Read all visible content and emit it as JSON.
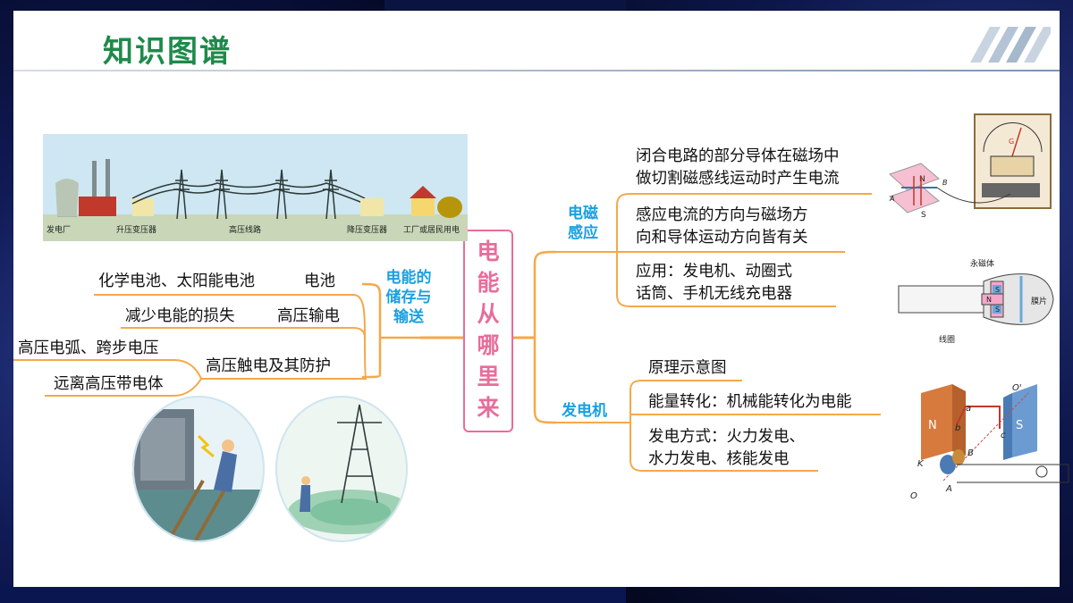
{
  "title": "知识图谱",
  "center": [
    "电",
    "能",
    "从",
    "哪",
    "里",
    "来"
  ],
  "left_branch": {
    "title_lines": [
      "电能的",
      "储存与",
      "输送"
    ],
    "battery": {
      "examples": "化学电池、太阳能电池",
      "label": "电池"
    },
    "hv": {
      "examples": "减少电能的损失",
      "label": "高压输电"
    },
    "shock": {
      "label": "高压触电及其防护",
      "items": [
        "高压电弧、跨步电压",
        "远离高压带电体"
      ]
    }
  },
  "right_branch": {
    "emi": {
      "title_lines": [
        "电磁",
        "感应"
      ],
      "items": [
        [
          "闭合电路的部分导体在磁场中",
          "做切割磁感线运动时产生电流"
        ],
        [
          "感应电流的方向与磁场方",
          "向和导体运动方向皆有关"
        ],
        [
          "应用：发电机、动圈式",
          "话筒、手机无线充电器"
        ]
      ]
    },
    "generator": {
      "title": "发电机",
      "items": [
        [
          "原理示意图"
        ],
        [
          "能量转化：机械能转化为电能"
        ],
        [
          "发电方式：火力发电、",
          "水力发电、核能发电"
        ]
      ]
    }
  },
  "transmission_labels": [
    "发电厂",
    "升压变压器",
    "高压线路",
    "降压变压器",
    "工厂或居民用电"
  ],
  "mic_labels": {
    "magnet": "永磁体",
    "diaphragm": "膜片",
    "coil": "线圈",
    "s1": "S",
    "n": "N",
    "s2": "S"
  },
  "generator_labels": {
    "n": "N",
    "s": "S",
    "a": "a",
    "b": "b",
    "c": "c",
    "o_prime": "O'",
    "o": "O",
    "k": "K",
    "B": "B",
    "A": "A"
  },
  "galv_labels": {
    "n": "N",
    "s": "S",
    "g": "G",
    "b": "B",
    "a": "A"
  }
}
